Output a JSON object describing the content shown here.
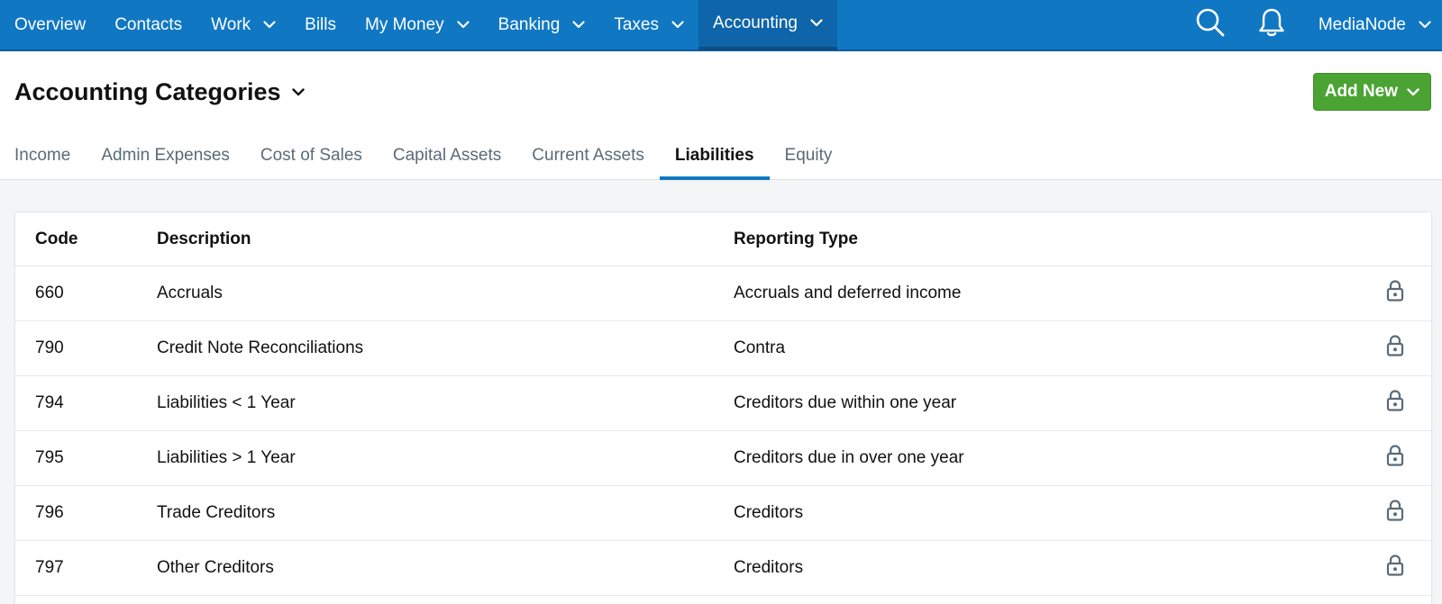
{
  "nav": {
    "items": [
      {
        "label": "Overview",
        "dropdown": false
      },
      {
        "label": "Contacts",
        "dropdown": false
      },
      {
        "label": "Work",
        "dropdown": true
      },
      {
        "label": "Bills",
        "dropdown": false
      },
      {
        "label": "My Money",
        "dropdown": true
      },
      {
        "label": "Banking",
        "dropdown": true
      },
      {
        "label": "Taxes",
        "dropdown": true
      },
      {
        "label": "Accounting",
        "dropdown": true,
        "active": true
      }
    ],
    "user": "MediaNode"
  },
  "header": {
    "title": "Accounting Categories",
    "add_new_label": "Add New"
  },
  "tabs": [
    {
      "label": "Income"
    },
    {
      "label": "Admin Expenses"
    },
    {
      "label": "Cost of Sales"
    },
    {
      "label": "Capital Assets"
    },
    {
      "label": "Current Assets"
    },
    {
      "label": "Liabilities",
      "active": true
    },
    {
      "label": "Equity"
    }
  ],
  "table": {
    "headers": {
      "code": "Code",
      "description": "Description",
      "reporting_type": "Reporting Type"
    },
    "rows": [
      {
        "code": "660",
        "description": "Accruals",
        "reporting_type": "Accruals and deferred income"
      },
      {
        "code": "790",
        "description": "Credit Note Reconciliations",
        "reporting_type": "Contra"
      },
      {
        "code": "794",
        "description": "Liabilities < 1 Year",
        "reporting_type": "Creditors due within one year"
      },
      {
        "code": "795",
        "description": "Liabilities > 1 Year",
        "reporting_type": "Creditors due in over one year"
      },
      {
        "code": "796",
        "description": "Trade Creditors",
        "reporting_type": "Creditors"
      },
      {
        "code": "797",
        "description": "Other Creditors",
        "reporting_type": "Creditors"
      }
    ]
  },
  "colors": {
    "nav_bg": "#1077c3",
    "add_new_bg": "#4aa332",
    "tab_active_underline": "#1077c3",
    "lock_icon": "#5a6b78"
  },
  "icons": {
    "search": "search-icon",
    "notifications": "bell-icon",
    "lock": "lock-icon",
    "chevron": "chevron-down-icon"
  }
}
